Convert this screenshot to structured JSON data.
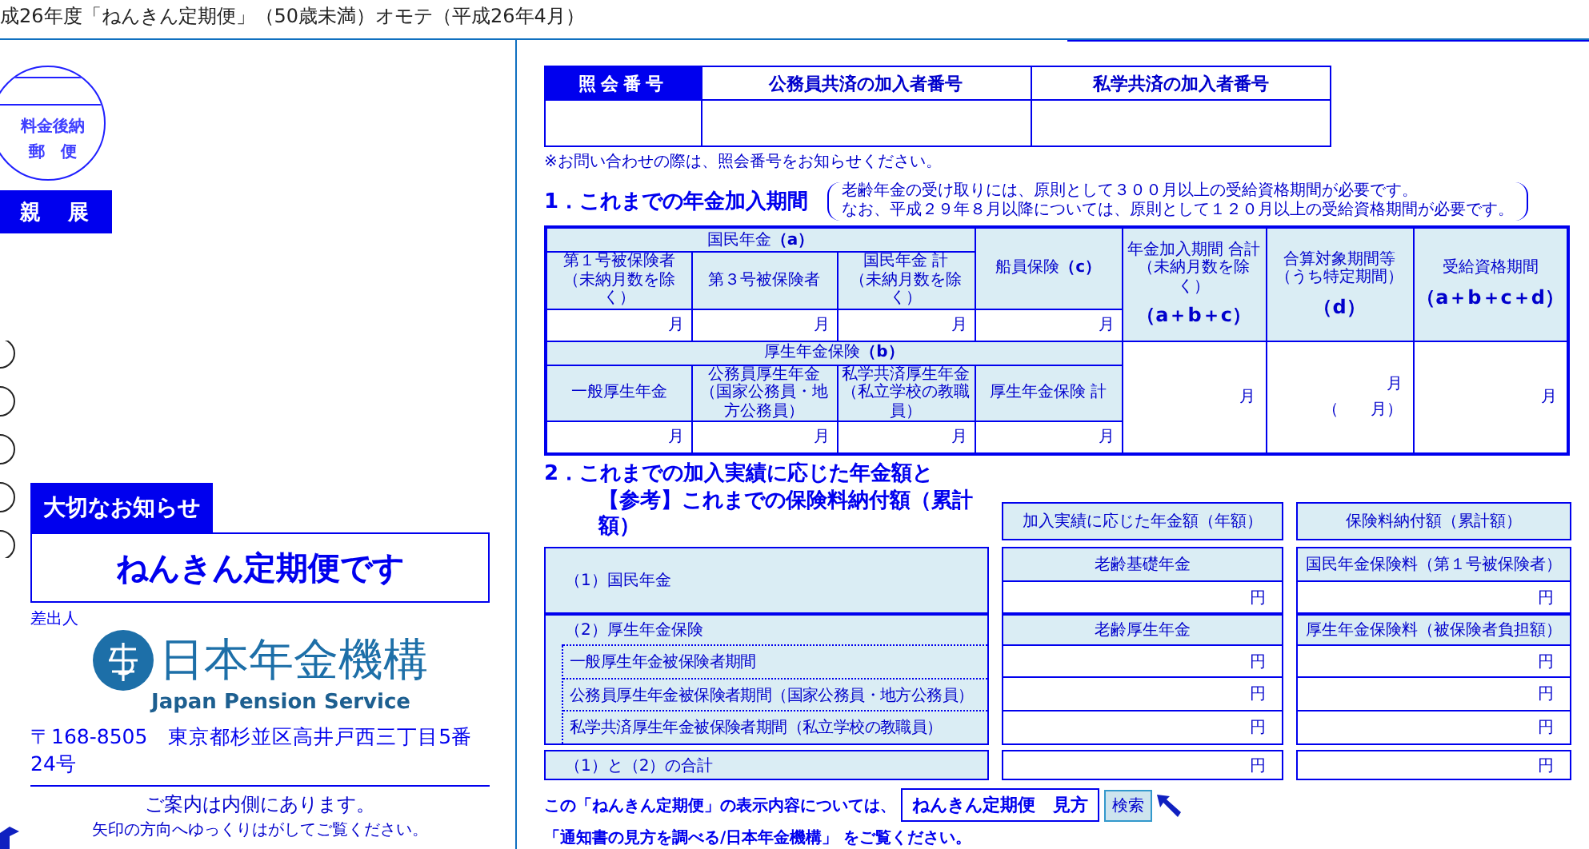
{
  "header_title": "成26年度「ねんきん定期便」（50歳未満）オモテ（平成26年4月）",
  "envelope": {
    "stamp_lines": [
      "料金後納",
      "郵　便"
    ],
    "confidential": "親　展",
    "notice_tab": "大切なお知らせ",
    "notice_title": "ねんきん定期便です",
    "sender_label": "差出人",
    "org_name": "日本年金機構",
    "org_name_en": "Japan Pension Service",
    "address": "〒168-8505　東京都杉並区高井戸西三丁目5番24号",
    "guide": "ご案内は内側にあります。",
    "guide_note": "矢印の方向へゆっくりはがしてご覧ください。"
  },
  "reference_numbers": {
    "columns": [
      {
        "label": "照会番号",
        "highlighted": true
      },
      {
        "label": "公務員共済の加入者番号",
        "highlighted": false
      },
      {
        "label": "私学共済の加入者番号",
        "highlighted": false
      }
    ],
    "note": "※お問い合わせの際は、照会番号をお知らせください。"
  },
  "section1": {
    "title": "1．これまでの年金加入期間",
    "note_lines": [
      "老齢年金の受け取りには、原則として３００月以上の受給資格期間が必要です。",
      "なお、平成２９年８月以降については、原則として１２０月以上の受給資格期間が必要です。"
    ],
    "national": {
      "label": "国民年金**（a）**",
      "columns": [
        {
          "label": "第１号被保険者",
          "sub": "（未納月数を除く）"
        },
        {
          "label": "第３号被保険者"
        },
        {
          "label": "国民年金 計",
          "sub": "（未納月数を除く）"
        }
      ],
      "cells": [
        "月",
        "月",
        "月"
      ]
    },
    "seaman": {
      "label": "船員保険**（c）**",
      "cell": "月"
    },
    "employee": {
      "label": "厚生年金保険**（b）**",
      "columns": [
        {
          "label": "一般厚生年金"
        },
        {
          "label": "公務員厚生年金",
          "sub": "（国家公務員・地方公務員）"
        },
        {
          "label": "私学共済厚生年金",
          "sub": "（私立学校の教職員）"
        },
        {
          "label": "厚生年金保険 計"
        }
      ],
      "cells": [
        "月",
        "月",
        "月",
        "月"
      ]
    },
    "totals": [
      {
        "label": "年金加入期間 合計",
        "sub": "（未納月数を除く）",
        "formula": "（a＋b＋c）",
        "cell": "月"
      },
      {
        "label": "合算対象期間等",
        "sub": "（うち特定期間）",
        "formula": "（d）",
        "cell": "月",
        "cell_sub": "（　　月）"
      },
      {
        "label": "受給資格期間",
        "formula": "（a＋b＋c＋d）",
        "cell": "月"
      }
    ]
  },
  "section2": {
    "title_lines": [
      "2．これまでの加入実績に応じた年金額と",
      "【参考】これまでの保険料納付額（累計額）"
    ],
    "column_headers": [
      "加入実績に応じた年金額（年額）",
      "保険料納付額（累計額）"
    ],
    "national": {
      "label": "（1）国民年金",
      "benefit_label": "老齢基礎年金",
      "benefit": "円",
      "premium_label": "国民年金保険料（第１号被保険者）",
      "premium": "円"
    },
    "employee": {
      "label": "（2）厚生年金保険",
      "benefit_label": "老齢厚生年金",
      "premium_label": "厚生年金保険料（被保険者負担額）",
      "subrows": [
        {
          "label": "一般厚生年金被保険者期間",
          "benefit": "円",
          "premium": "円"
        },
        {
          "label": "公務員厚生年金被保険者期間（国家公務員・地方公務員）",
          "benefit": "円",
          "premium": "円"
        },
        {
          "label": "私学共済厚生年金被保険者期間（私立学校の教職員）",
          "benefit": "円",
          "premium": "円"
        }
      ]
    },
    "total": {
      "label": "（1）と（2）の合計",
      "benefit": "円",
      "premium": "円"
    }
  },
  "footer": {
    "lead": "この「ねんきん定期便」の表示内容については、",
    "search_value": "ねんきん定期便　見方",
    "search_button": "検索",
    "tail": "「通知書の見方を調べる/日本年金機構」 をご覧ください。"
  }
}
